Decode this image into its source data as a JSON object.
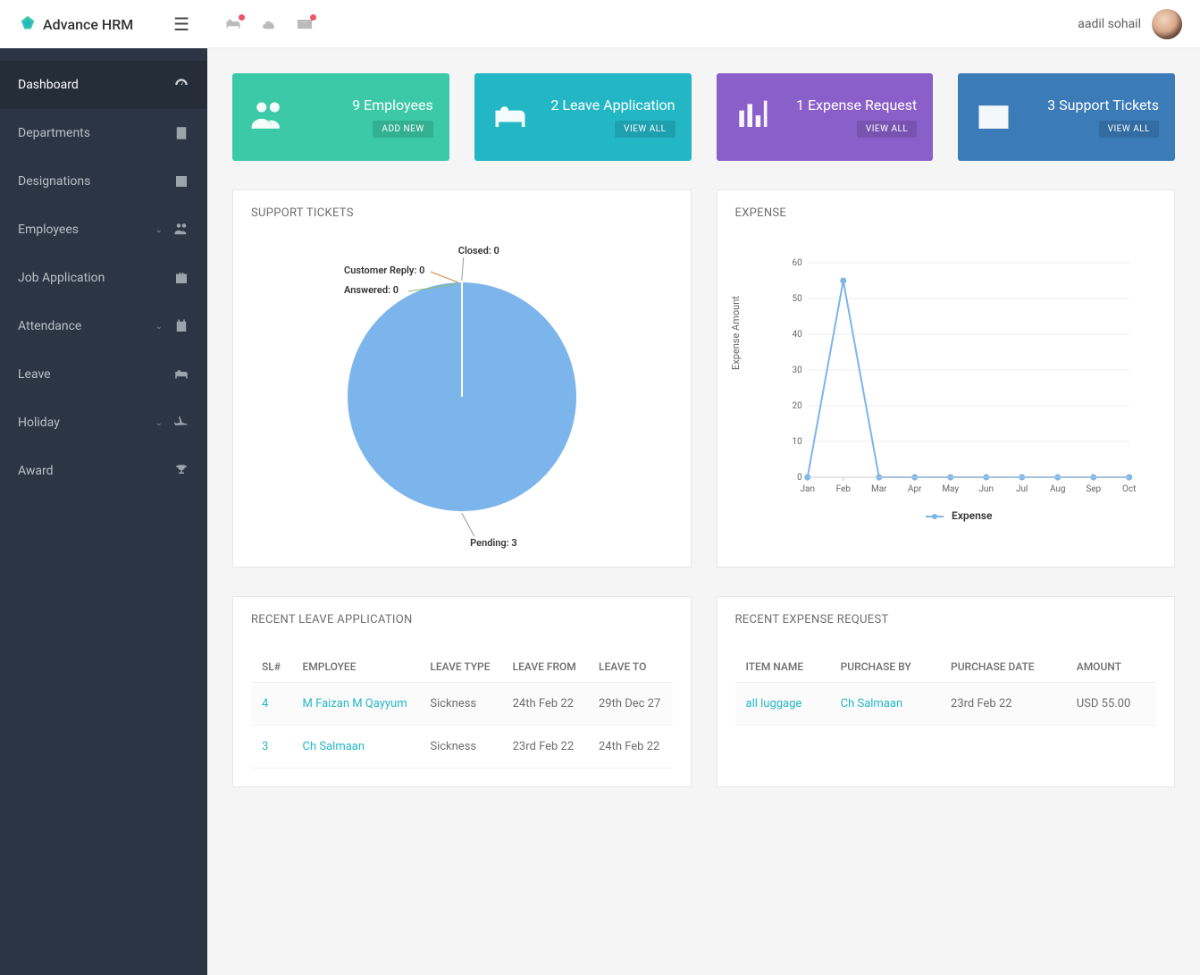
{
  "brand": "Advance HRM",
  "user": {
    "name": "aadil sohail"
  },
  "sidebar": {
    "items": [
      {
        "label": "Dashboard",
        "icon": "dashboard",
        "active": true,
        "expandable": false
      },
      {
        "label": "Departments",
        "icon": "building",
        "active": false,
        "expandable": false
      },
      {
        "label": "Designations",
        "icon": "id",
        "active": false,
        "expandable": false
      },
      {
        "label": "Employees",
        "icon": "users",
        "active": false,
        "expandable": true
      },
      {
        "label": "Job Application",
        "icon": "briefcase",
        "active": false,
        "expandable": false
      },
      {
        "label": "Attendance",
        "icon": "calendar",
        "active": false,
        "expandable": true
      },
      {
        "label": "Leave",
        "icon": "bed",
        "active": false,
        "expandable": false
      },
      {
        "label": "Holiday",
        "icon": "plane",
        "active": false,
        "expandable": true
      },
      {
        "label": "Award",
        "icon": "trophy",
        "active": false,
        "expandable": false
      }
    ]
  },
  "stats": [
    {
      "count": "9",
      "label": "Employees",
      "button": "ADD NEW",
      "color": "teal",
      "icon": "users"
    },
    {
      "count": "2",
      "label": "Leave Application",
      "button": "VIEW ALL",
      "color": "blue",
      "icon": "bed"
    },
    {
      "count": "1",
      "label": "Expense Request",
      "button": "VIEW ALL",
      "color": "purple",
      "icon": "bars"
    },
    {
      "count": "3",
      "label": "Support Tickets",
      "button": "VIEW ALL",
      "color": "dblue",
      "icon": "envelope"
    }
  ],
  "panels": {
    "support_tickets_title": "SUPPORT TICKETS",
    "expense_title": "EXPENSE",
    "recent_leave_title": "RECENT LEAVE APPLICATION",
    "recent_expense_title": "RECENT EXPENSE REQUEST"
  },
  "chart_data": [
    {
      "type": "pie",
      "title": "SUPPORT TICKETS",
      "series": [
        {
          "name": "Pending",
          "value": 3
        },
        {
          "name": "Closed",
          "value": 0
        },
        {
          "name": "Customer Reply",
          "value": 0
        },
        {
          "name": "Answered",
          "value": 0
        }
      ],
      "labels": {
        "pending": "Pending: 3",
        "closed": "Closed: 0",
        "customer_reply": "Customer Reply: 0",
        "answered": "Answered: 0"
      }
    },
    {
      "type": "line",
      "title": "EXPENSE",
      "ylabel": "Expense Amount",
      "ylim": [
        0,
        60
      ],
      "yticks": [
        0,
        10,
        20,
        30,
        40,
        50,
        60
      ],
      "categories": [
        "Jan",
        "Feb",
        "Mar",
        "Apr",
        "May",
        "Jun",
        "Jul",
        "Aug",
        "Sep",
        "Oct"
      ],
      "series": [
        {
          "name": "Expense",
          "values": [
            0,
            55,
            0,
            0,
            0,
            0,
            0,
            0,
            0,
            0
          ]
        }
      ],
      "legend": "Expense"
    }
  ],
  "leave_table": {
    "headers": [
      "SL#",
      "EMPLOYEE",
      "LEAVE TYPE",
      "LEAVE FROM",
      "LEAVE TO"
    ],
    "rows": [
      {
        "sl": "4",
        "employee": "M Faizan M Qayyum",
        "type": "Sickness",
        "from": "24th Feb 22",
        "to": "29th Dec 27"
      },
      {
        "sl": "3",
        "employee": "Ch Salmaan",
        "type": "Sickness",
        "from": "23rd Feb 22",
        "to": "24th Feb 22"
      }
    ]
  },
  "expense_table": {
    "headers": [
      "ITEM NAME",
      "PURCHASE BY",
      "PURCHASE DATE",
      "AMOUNT"
    ],
    "rows": [
      {
        "item": "all luggage",
        "by": "Ch Salmaan",
        "date": "23rd Feb 22",
        "amount": "USD 55.00"
      }
    ]
  }
}
